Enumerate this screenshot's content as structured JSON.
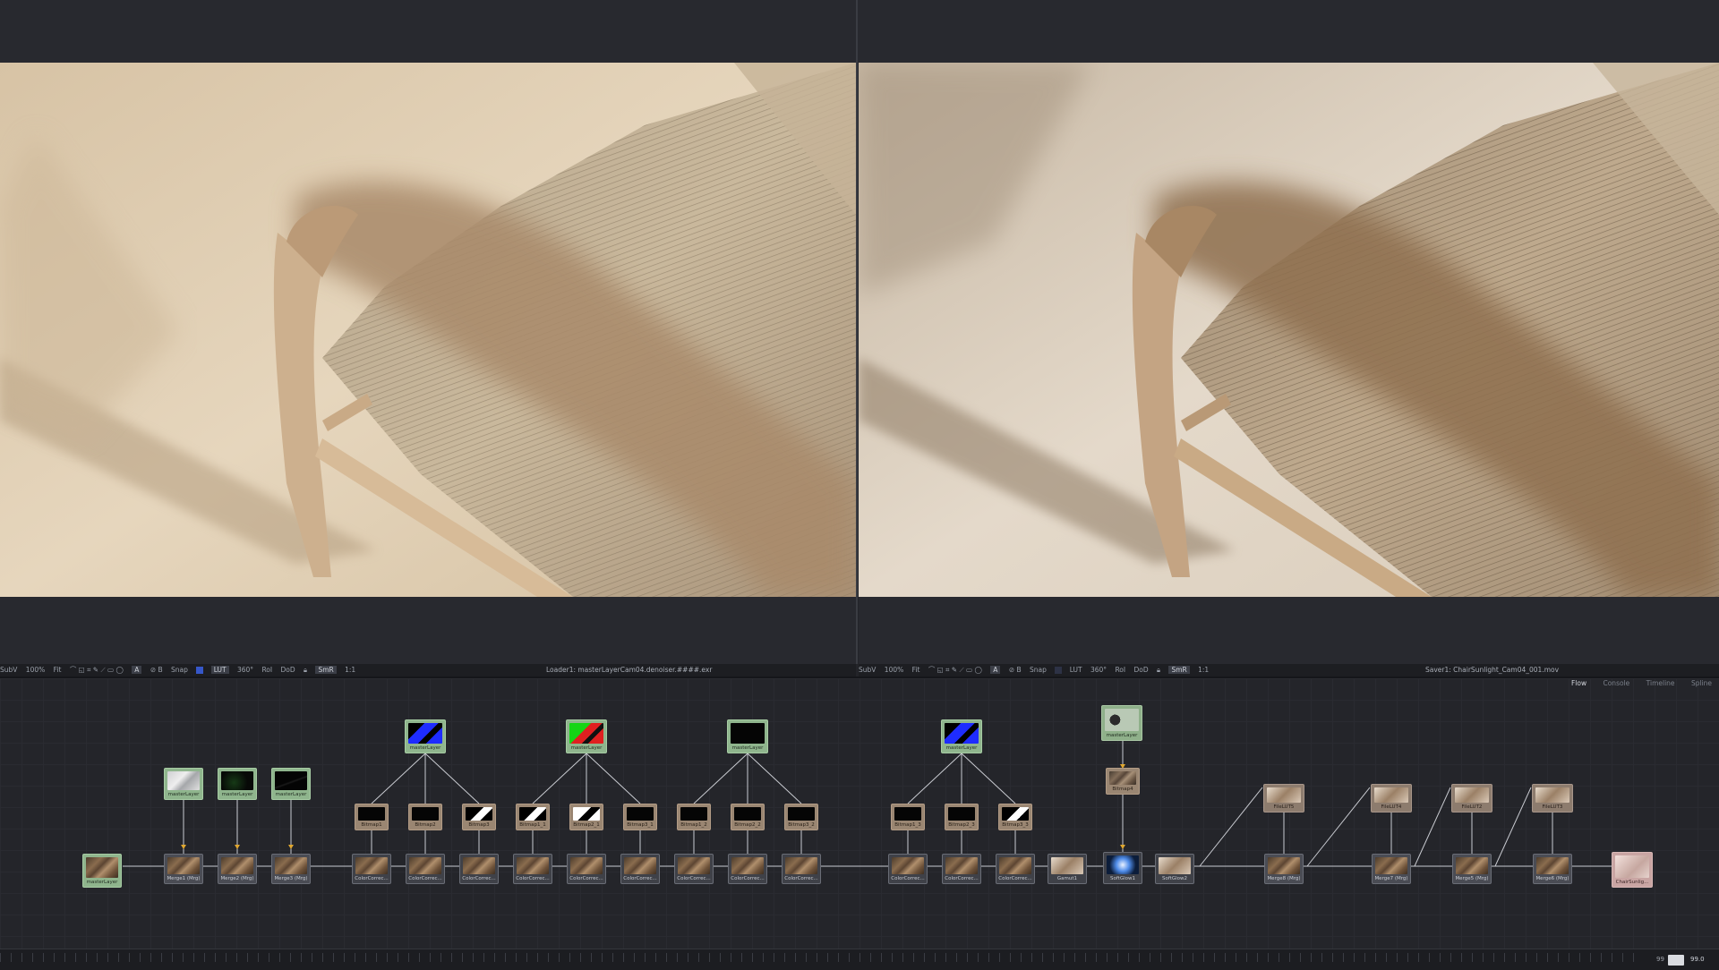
{
  "viewers": {
    "left": {
      "title": "Loader1: masterLayerCam04.denoiser.####.exr",
      "toolbar": [
        "SubV",
        "100%",
        "Fit",
        "Snap",
        "LUT",
        "360°",
        "RoI",
        "DoD",
        "SmR",
        "1:1"
      ],
      "subv": "SubV",
      "zoom": "100%",
      "fit": "Fit",
      "snap": "Snap",
      "lut": "LUT",
      "angle": "360°",
      "roi": "RoI",
      "dod": "DoD",
      "smr": "SmR",
      "ratio": "1:1"
    },
    "right": {
      "title": "Saver1: ChairSunlight_Cam04_001.mov",
      "subv": "SubV",
      "zoom": "100%",
      "fit": "Fit",
      "snap": "Snap",
      "lut": "LUT",
      "angle": "360°",
      "roi": "RoI",
      "dod": "DoD",
      "smr": "SmR",
      "ratio": "1:1"
    }
  },
  "flow_tabs": [
    "Flow",
    "Console",
    "Timeline",
    "Spline"
  ],
  "nodes": {
    "loader_main": "masterLayer",
    "loader_a": "masterLayer",
    "loader_b": "masterLayer",
    "loader_c": "masterLayer",
    "loader_blue1": "masterLayer",
    "loader_green": "masterLayer",
    "loader_black": "masterLayer",
    "loader_blue2": "masterLayer",
    "fast_noise": "masterLayer",
    "merge1": "Merge1 (Mrg)",
    "merge2": "Merge2 (Mrg)",
    "merge3": "Merge3 (Mrg)",
    "merge6": "Merge6 (Mrg)",
    "merge7": "Merge7 (Mrg)",
    "merge5": "Merge5 (Mrg)",
    "merge8": "Merge8 (Mrg)",
    "bitmap1": "Bitmap1",
    "bitmap2": "Bitmap2",
    "bitmap3": "Bitmap3",
    "bitmap1_1": "Bitmap1_1",
    "bitmap2_1": "Bitmap2_1",
    "bitmap3_1": "Bitmap3_1",
    "bitmap1_2": "Bitmap1_2",
    "bitmap2_2": "Bitmap2_2",
    "bitmap3_2": "Bitmap3_2",
    "bitmap1_3": "Bitmap1_3",
    "bitmap2_3": "Bitmap2_3",
    "bitmap3_3": "Bitmap3_3",
    "bitmap4": "Bitmap4",
    "cc": "ColorCorrec...",
    "gamut1": "Gamut1",
    "softglow1": "SoftGlow1",
    "softglow2": "SoftGlow2",
    "filelut1": "FileLUT5",
    "filelut2": "FileLUT4",
    "filelut3": "FileLUT2",
    "filelut4": "FileLUT3",
    "saver": "ChairSunlig..."
  },
  "timeline": {
    "current_left": "99",
    "current_right": "99.0"
  },
  "colors": {
    "accent": "#d9b04a",
    "loader": "#8fb58d",
    "bitmap": "#9a8672",
    "saver": "#c9a5a3"
  }
}
